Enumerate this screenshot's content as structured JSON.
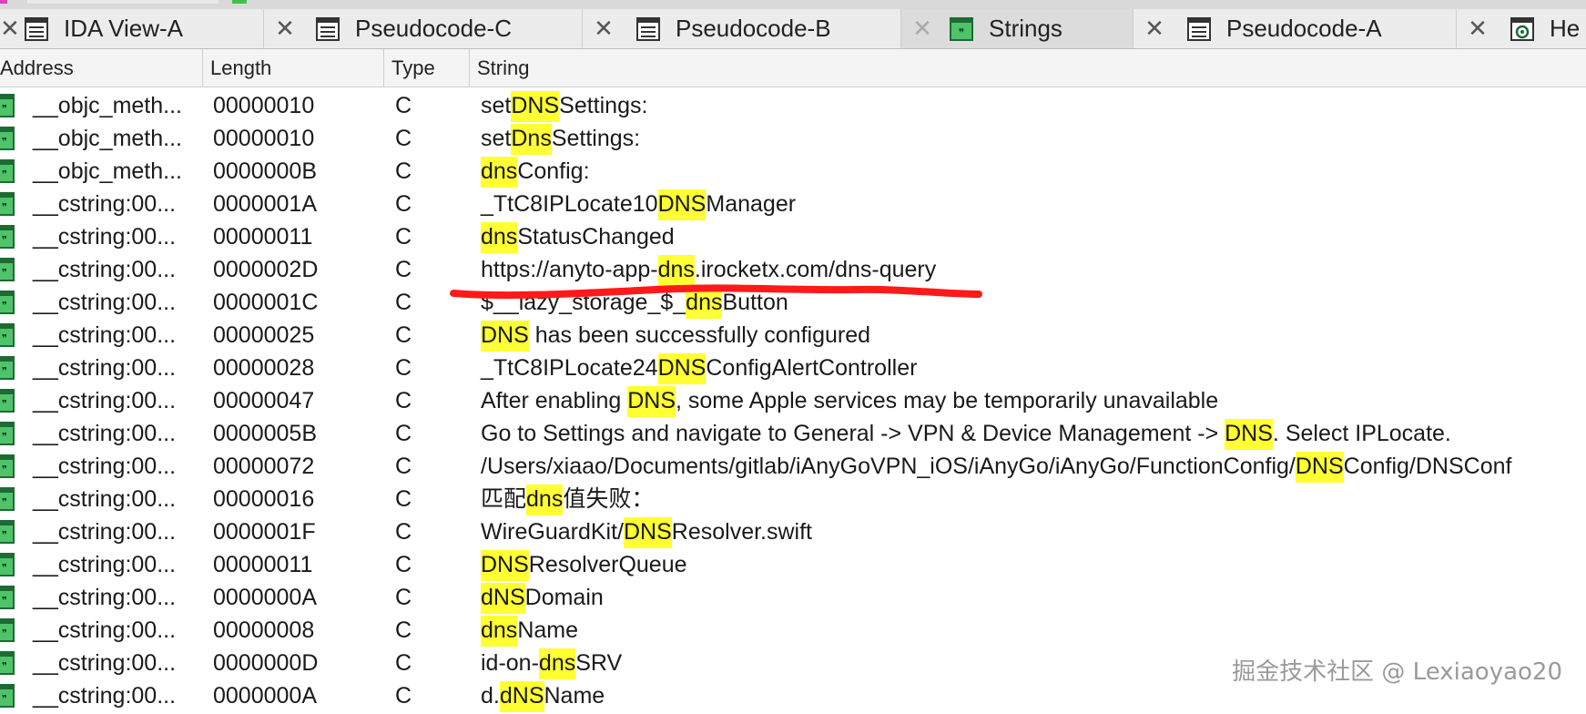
{
  "tabs": [
    {
      "label": "IDA View-A",
      "icon": "text-view-icon"
    },
    {
      "label": "Pseudocode-C",
      "icon": "text-view-icon"
    },
    {
      "label": "Pseudocode-B",
      "icon": "text-view-icon"
    },
    {
      "label": "Strings",
      "icon": "strings-icon",
      "active": true
    },
    {
      "label": "Pseudocode-A",
      "icon": "text-view-icon"
    },
    {
      "label": "He",
      "icon": "hex-view-icon"
    }
  ],
  "columns": [
    "Address",
    "Length",
    "Type",
    "String"
  ],
  "highlight_color": "#ffff33",
  "annotation_color": "#ff1a1a",
  "rows": [
    {
      "address": "__objc_meth...",
      "length": "00000010",
      "type": "C",
      "string": [
        "set",
        "DNS",
        "Settings:"
      ]
    },
    {
      "address": "__objc_meth...",
      "length": "00000010",
      "type": "C",
      "string": [
        "set",
        "Dns",
        "Settings:"
      ]
    },
    {
      "address": "__objc_meth...",
      "length": "0000000B",
      "type": "C",
      "string": [
        "",
        "dns",
        "Config:"
      ]
    },
    {
      "address": "__cstring:00...",
      "length": "0000001A",
      "type": "C",
      "string": [
        "_TtC8IPLocate10",
        "DNS",
        "Manager"
      ]
    },
    {
      "address": "__cstring:00...",
      "length": "00000011",
      "type": "C",
      "string": [
        "",
        "dns",
        "StatusChanged"
      ]
    },
    {
      "address": "__cstring:00...",
      "length": "0000002D",
      "type": "C",
      "string": [
        "https://anyto-app-",
        "dns",
        ".irocketx.com/dns-query"
      ]
    },
    {
      "address": "__cstring:00...",
      "length": "0000001C",
      "type": "C",
      "string": [
        "$__lazy_storage_$_",
        "dns",
        "Button"
      ]
    },
    {
      "address": "__cstring:00...",
      "length": "00000025",
      "type": "C",
      "string": [
        "",
        "DNS",
        " has been successfully configured"
      ]
    },
    {
      "address": "__cstring:00...",
      "length": "00000028",
      "type": "C",
      "string": [
        "_TtC8IPLocate24",
        "DNS",
        "ConfigAlertController"
      ]
    },
    {
      "address": "__cstring:00...",
      "length": "00000047",
      "type": "C",
      "string": [
        "After enabling ",
        "DNS",
        ", some Apple services may be temporarily unavailable"
      ]
    },
    {
      "address": "__cstring:00...",
      "length": "0000005B",
      "type": "C",
      "string": [
        "Go to Settings and navigate to General -> VPN & Device Management -> ",
        "DNS",
        ". Select IPLocate."
      ]
    },
    {
      "address": "__cstring:00...",
      "length": "00000072",
      "type": "C",
      "string": [
        "/Users/xiaao/Documents/gitlab/iAnyGoVPN_iOS/iAnyGo/iAnyGo/FunctionConfig/",
        "DNS",
        "Config/DNSConf"
      ]
    },
    {
      "address": "__cstring:00...",
      "length": "00000016",
      "type": "C",
      "string": [
        "匹配",
        "dns",
        "值失败："
      ]
    },
    {
      "address": "__cstring:00...",
      "length": "0000001F",
      "type": "C",
      "string": [
        "WireGuardKit/",
        "DNS",
        "Resolver.swift"
      ]
    },
    {
      "address": "__cstring:00...",
      "length": "00000011",
      "type": "C",
      "string": [
        "",
        "DNS",
        "ResolverQueue"
      ]
    },
    {
      "address": "__cstring:00...",
      "length": "0000000A",
      "type": "C",
      "string": [
        "",
        "dNS",
        "Domain"
      ]
    },
    {
      "address": "__cstring:00...",
      "length": "00000008",
      "type": "C",
      "string": [
        "",
        "dns",
        "Name"
      ]
    },
    {
      "address": "__cstring:00...",
      "length": "0000000D",
      "type": "C",
      "string": [
        "id-on-",
        "dns",
        "SRV"
      ]
    },
    {
      "address": "__cstring:00...",
      "length": "0000000A",
      "type": "C",
      "string": [
        "d.",
        "dNS",
        "Name"
      ]
    }
  ],
  "watermark": "掘金技术社区 @ Lexiaoyao20"
}
